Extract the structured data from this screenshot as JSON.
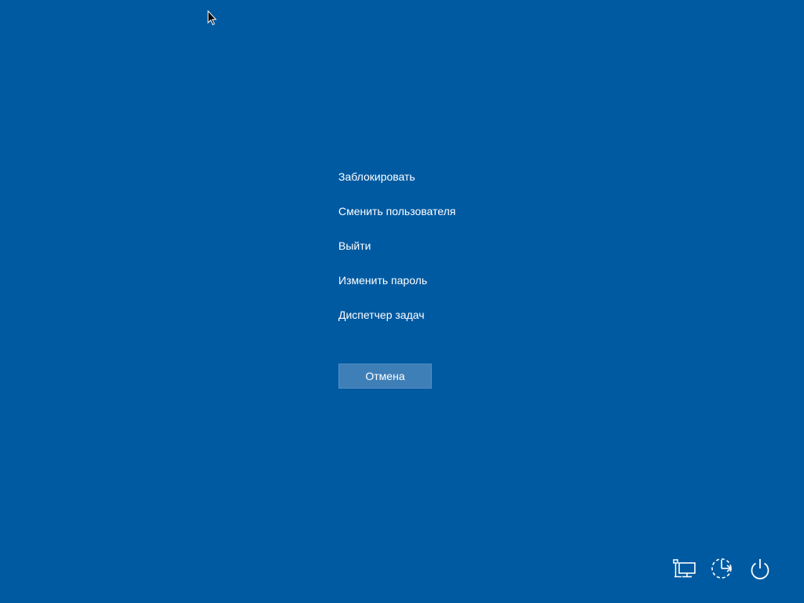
{
  "menu": {
    "items": [
      {
        "label": "Заблокировать"
      },
      {
        "label": "Сменить пользователя"
      },
      {
        "label": "Выйти"
      },
      {
        "label": "Изменить пароль"
      },
      {
        "label": "Диспетчер задач"
      }
    ]
  },
  "cancel": {
    "label": "Отмена"
  },
  "tray": {
    "icons": [
      "network-icon",
      "ease-of-access-icon",
      "power-icon"
    ]
  },
  "colors": {
    "background": "#005aa2",
    "button": "#3f7fb8",
    "text": "#ffffff"
  }
}
